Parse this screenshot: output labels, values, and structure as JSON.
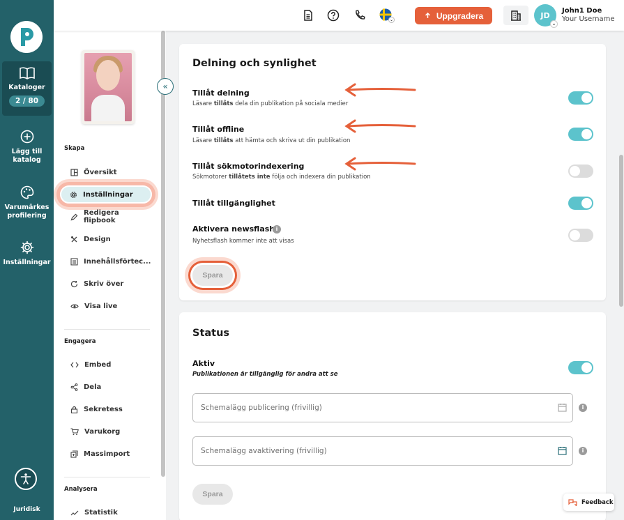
{
  "rail": {
    "items": [
      {
        "label_1": "Kataloger",
        "label_2": "",
        "icon": "book-icon"
      },
      {
        "label_1": "Lägg till",
        "label_2": "katalog",
        "icon": "plus-circle-icon"
      },
      {
        "label_1": "Varumärkes",
        "label_2": "profilering",
        "icon": "palette-icon"
      },
      {
        "label_1": "Inställningar",
        "label_2": "",
        "icon": "gear-icon"
      }
    ],
    "catalog_count": "2 / 80",
    "footer_link": "Juridisk"
  },
  "topbar": {
    "upgrade_label": "Uppgradera",
    "user_initials": "JD",
    "user_name": "John1 Doe",
    "user_sub": "Your Username",
    "icons": [
      "document-icon",
      "help-icon",
      "phone-icon",
      "sweden-flag-icon",
      "building-icon"
    ]
  },
  "subnav": {
    "sections": [
      {
        "title": "Skapa",
        "items": [
          "Översikt",
          "Inställningar",
          "Redigera flipbook",
          "Design",
          "Innehållsförtec...",
          "Skriv över",
          "Visa live"
        ]
      },
      {
        "title": "Engagera",
        "items": [
          "Embed",
          "Dela",
          "Sekretess",
          "Varukorg",
          "Massimport"
        ]
      },
      {
        "title": "Analysera",
        "items": [
          "Statistik"
        ]
      }
    ],
    "active_item": "Inställningar"
  },
  "sharing": {
    "title": "Delning och synlighet",
    "rows": [
      {
        "title": "Tillåt delning",
        "sub_pre": "Läsare ",
        "sub_bold": "tillåts",
        "sub_post": " dela din publikation på sociala medier",
        "on": true
      },
      {
        "title": "Tillåt offline",
        "sub_pre": "Läsare ",
        "sub_bold": "tillåts",
        "sub_post": " att hämta och skriva ut din publikation",
        "on": true
      },
      {
        "title": "Tillåt sökmotorindexering",
        "sub_pre": "Sökmotorer ",
        "sub_bold": "tillåtets inte",
        "sub_post": " följa och indexera din publikation",
        "on": false
      },
      {
        "title": "Tillåt tillgänglighet",
        "on": true
      },
      {
        "title": "Aktivera newsflash",
        "sub": "Nyhetsflash kommer inte att visas",
        "on": false
      }
    ],
    "save_label": "Spara"
  },
  "status": {
    "title": "Status",
    "active_title": "Aktiv",
    "active_sub": "Publikationen är tillgänglig för andra att se",
    "active_on": true,
    "schedule_publish_placeholder": "Schemalägg publicering (frivillig)",
    "schedule_deactivate_placeholder": "Schemalägg avaktivering (frivillig)",
    "save_label": "Spara"
  },
  "feedback_label": "Feedback",
  "colors": {
    "rail": "#236169",
    "accent": "#5cc3cc",
    "cta": "#e5603a",
    "annotation": "#e5603a"
  }
}
